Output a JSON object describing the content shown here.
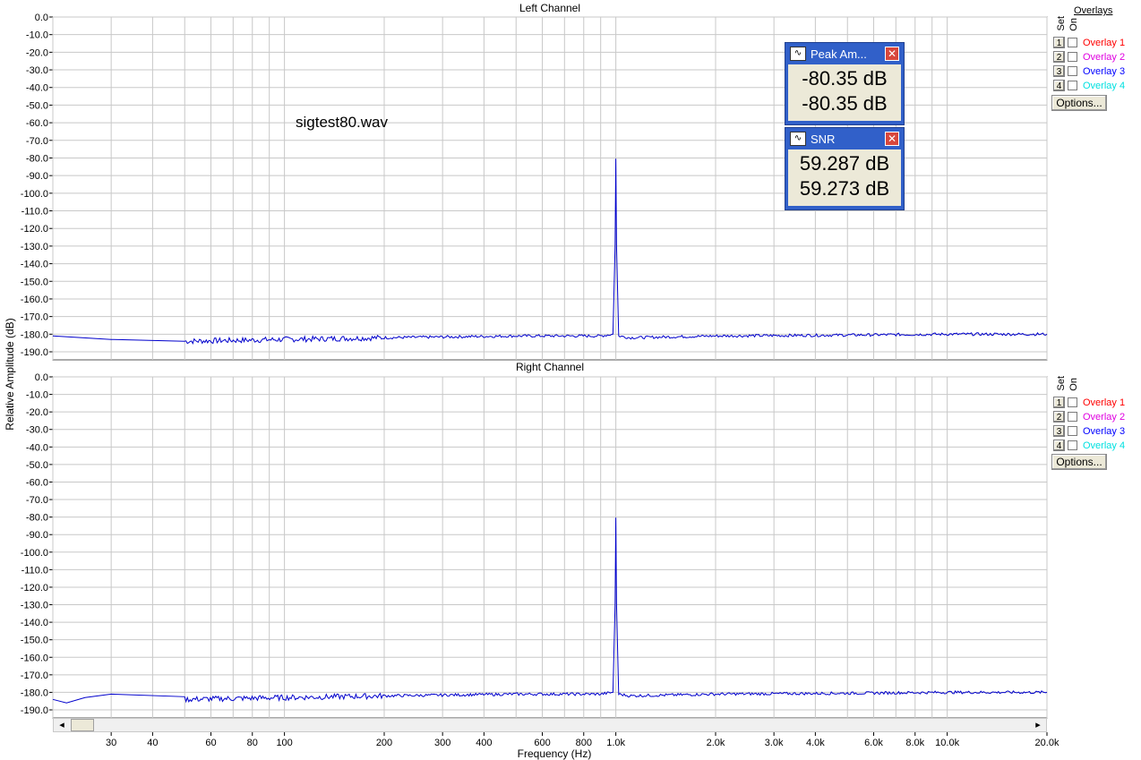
{
  "colors": {
    "trace": "#0000cc",
    "grid": "#c8c8c8",
    "frame": "#555555",
    "meter_title_bg": "#3160c9"
  },
  "panels": [
    {
      "title": "Left Channel",
      "file_label": "sigtest80.wav"
    },
    {
      "title": "Right Channel"
    }
  ],
  "axes": {
    "ylabel": "Relative Amplitude (dB)",
    "xlabel": "Frequency (Hz)",
    "y_ticks": [
      "0.0",
      "-10.0",
      "-20.0",
      "-30.0",
      "-40.0",
      "-50.0",
      "-60.0",
      "-70.0",
      "-80.0",
      "-90.0",
      "-100.0",
      "-110.0",
      "-120.0",
      "-130.0",
      "-140.0",
      "-150.0",
      "-160.0",
      "-170.0",
      "-180.0",
      "-190.0"
    ],
    "x_ticks": [
      {
        "v": 30,
        "label": "30"
      },
      {
        "v": 40,
        "label": "40"
      },
      {
        "v": 60,
        "label": "60"
      },
      {
        "v": 80,
        "label": "80"
      },
      {
        "v": 100,
        "label": "100"
      },
      {
        "v": 200,
        "label": "200"
      },
      {
        "v": 300,
        "label": "300"
      },
      {
        "v": 400,
        "label": "400"
      },
      {
        "v": 600,
        "label": "600"
      },
      {
        "v": 800,
        "label": "800"
      },
      {
        "v": 1000,
        "label": "1.0k"
      },
      {
        "v": 2000,
        "label": "2.0k"
      },
      {
        "v": 3000,
        "label": "3.0k"
      },
      {
        "v": 4000,
        "label": "4.0k"
      },
      {
        "v": 6000,
        "label": "6.0k"
      },
      {
        "v": 8000,
        "label": "8.0k"
      },
      {
        "v": 10000,
        "label": "10.0k"
      },
      {
        "v": 20000,
        "label": "20.0k"
      }
    ]
  },
  "chart_data": [
    {
      "type": "line",
      "title": "Left Channel",
      "xlabel": "Frequency (Hz)",
      "ylabel": "Relative Amplitude (dB)",
      "xscale": "log",
      "xlim": [
        20,
        20000
      ],
      "ylim": [
        -195,
        0
      ],
      "grid": true,
      "series": [
        {
          "x": [
            20,
            30,
            50,
            100,
            200,
            500,
            900,
            980,
            995,
            1000,
            1005,
            1020,
            1100,
            2000,
            5000,
            10000,
            20000
          ],
          "y": [
            -181,
            -183,
            -184,
            -183,
            -182,
            -181,
            -181,
            -180,
            -130,
            -80.35,
            -130,
            -181,
            -182,
            -181,
            -180.5,
            -180,
            -180
          ]
        }
      ]
    },
    {
      "type": "line",
      "title": "Right Channel",
      "xlabel": "Frequency (Hz)",
      "ylabel": "Relative Amplitude (dB)",
      "xscale": "log",
      "xlim": [
        20,
        20000
      ],
      "ylim": [
        -195,
        0
      ],
      "grid": true,
      "series": [
        {
          "x": [
            20,
            22,
            25,
            30,
            50,
            100,
            200,
            500,
            900,
            980,
            995,
            1000,
            1005,
            1020,
            1100,
            2000,
            5000,
            10000,
            20000
          ],
          "y": [
            -184,
            -186,
            -183,
            -181,
            -184,
            -183,
            -182,
            -181,
            -181,
            -180,
            -130,
            -80.35,
            -130,
            -181,
            -182,
            -181,
            -180.5,
            -180,
            -180
          ]
        }
      ]
    }
  ],
  "sidebar": {
    "overlays_label": "Overlays",
    "set_label": "Set",
    "on_label": "On",
    "options_label": "Options...",
    "overlays": [
      {
        "num": "1",
        "label": "Overlay 1",
        "color": "#ff0000"
      },
      {
        "num": "2",
        "label": "Overlay 2",
        "color": "#e000e0"
      },
      {
        "num": "3",
        "label": "Overlay 3",
        "color": "#0000ff"
      },
      {
        "num": "4",
        "label": "Overlay 4",
        "color": "#00e0e0"
      }
    ]
  },
  "meters": [
    {
      "title": "Peak Am...",
      "values": [
        "-80.35 dB",
        "-80.35 dB"
      ]
    },
    {
      "title": "SNR",
      "values": [
        "59.287 dB",
        "59.273 dB"
      ]
    }
  ],
  "scrollbar": {
    "left_arrow": "◂",
    "right_arrow": "▸"
  }
}
